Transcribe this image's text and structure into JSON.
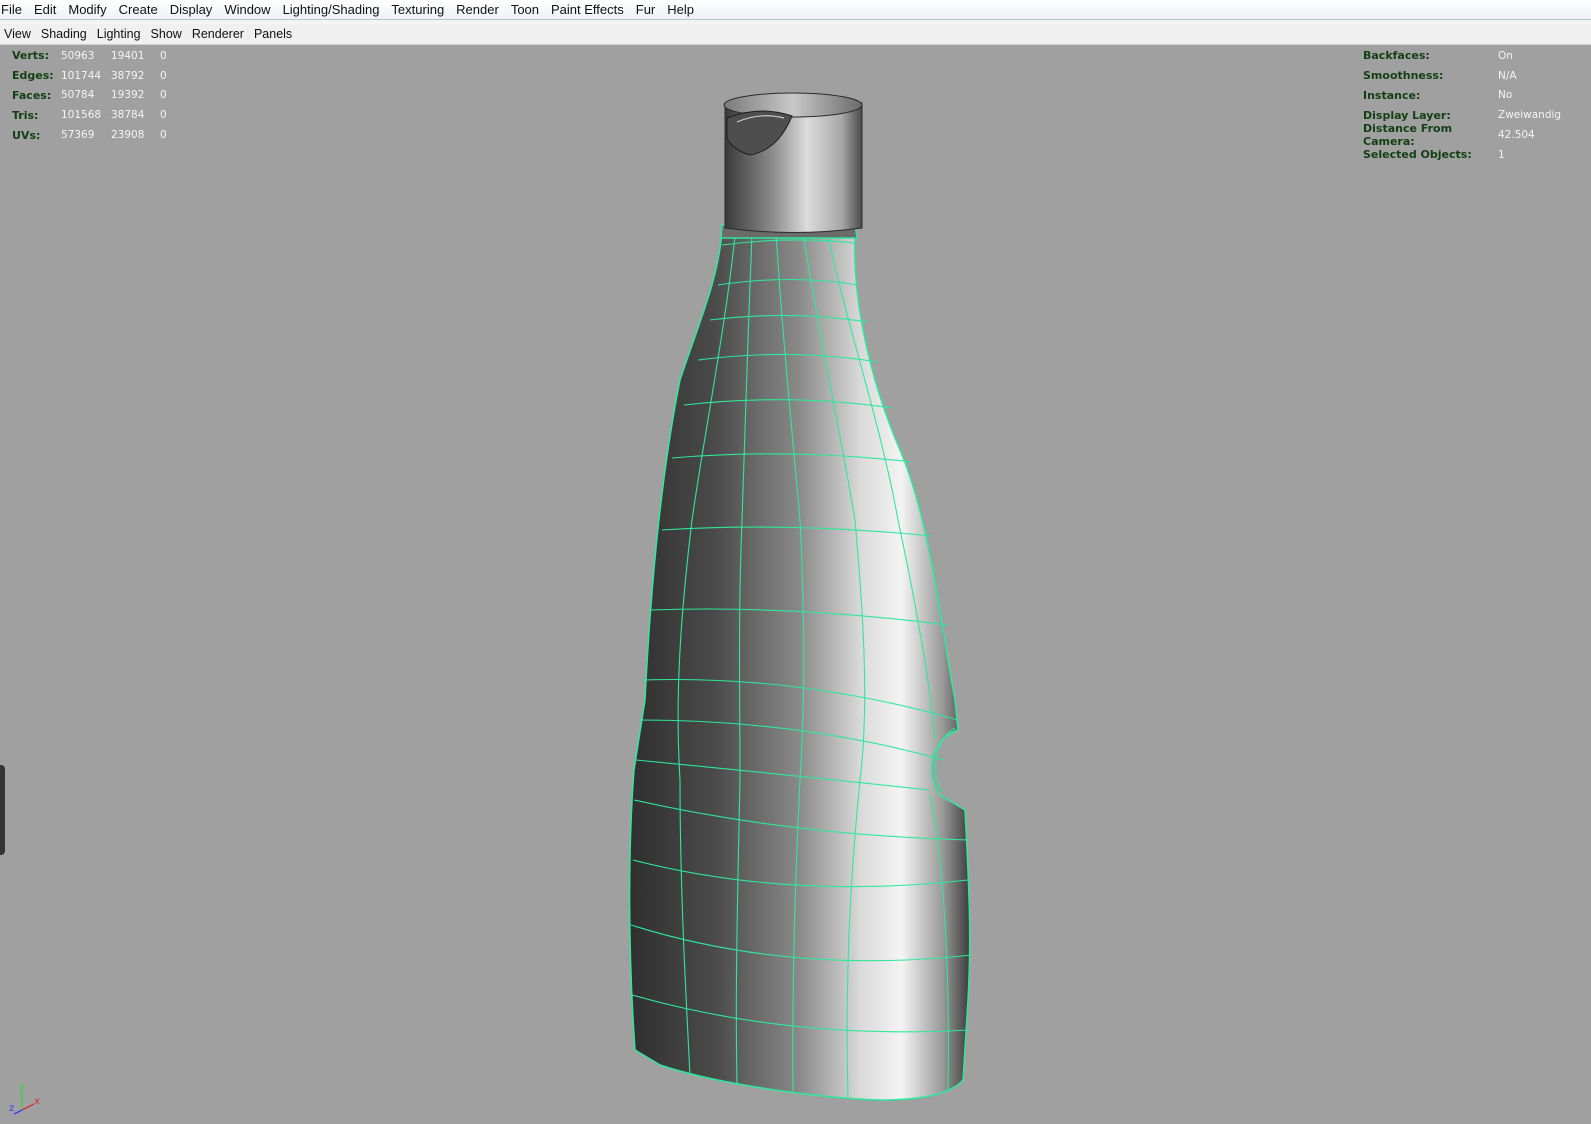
{
  "menubar": {
    "items": [
      "File",
      "Edit",
      "Modify",
      "Create",
      "Display",
      "Window",
      "Lighting/Shading",
      "Texturing",
      "Render",
      "Toon",
      "Paint Effects",
      "Fur",
      "Help"
    ]
  },
  "panel_menu": {
    "items": [
      "View",
      "Shading",
      "Lighting",
      "Show",
      "Renderer",
      "Panels"
    ]
  },
  "hud_left": {
    "rows": [
      {
        "label": "Verts:",
        "v1": "50963",
        "v2": "19401",
        "v3": "0"
      },
      {
        "label": "Edges:",
        "v1": "101744",
        "v2": "38792",
        "v3": "0"
      },
      {
        "label": "Faces:",
        "v1": "50784",
        "v2": "19392",
        "v3": "0"
      },
      {
        "label": "Tris:",
        "v1": "101568",
        "v2": "38784",
        "v3": "0"
      },
      {
        "label": "UVs:",
        "v1": "57369",
        "v2": "23908",
        "v3": "0"
      }
    ]
  },
  "hud_right": {
    "rows": [
      {
        "label": "Backfaces:",
        "value": "On"
      },
      {
        "label": "Smoothness:",
        "value": "N/A"
      },
      {
        "label": "Instance:",
        "value": "No"
      },
      {
        "label": "Display Layer:",
        "value": "Zweiwandig"
      },
      {
        "label": "Distance From Camera:",
        "value": "42.504"
      },
      {
        "label": "Selected Objects:",
        "value": "1"
      }
    ]
  },
  "axis": {
    "x": "x",
    "y": "y",
    "z": "z"
  },
  "colors": {
    "viewport_bg": "#a0a0a0",
    "wireframe": "#2ee89c",
    "hud_label": "#123f12",
    "hud_value": "#f4f4f4"
  }
}
